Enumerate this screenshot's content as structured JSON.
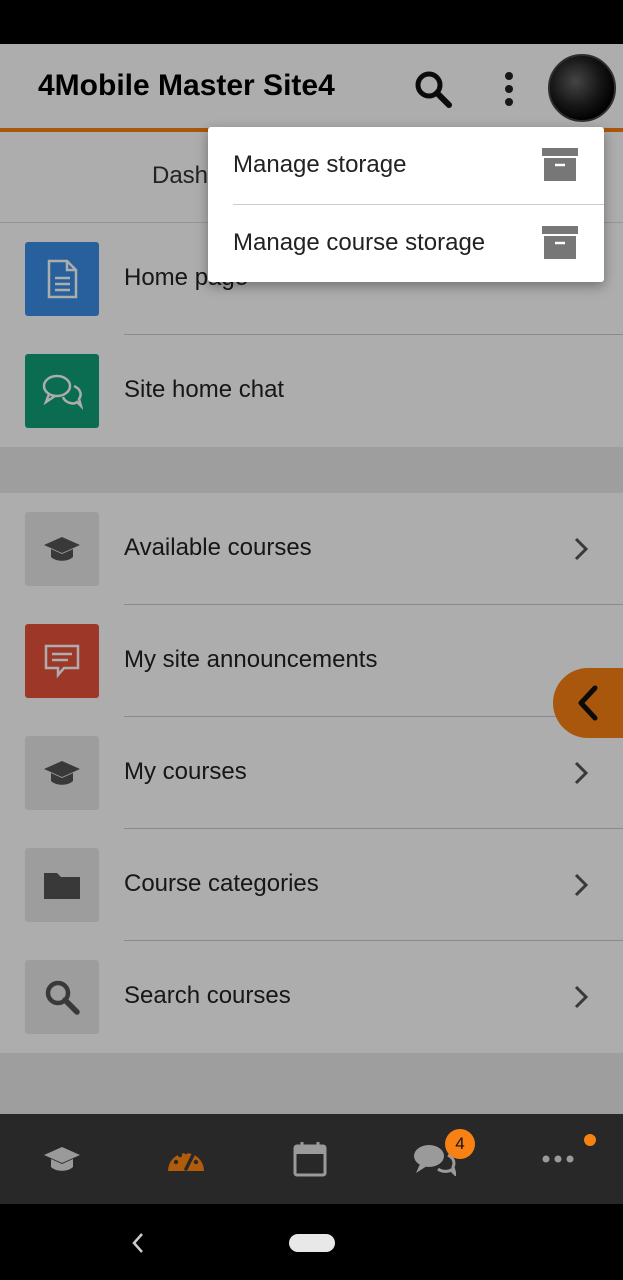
{
  "header": {
    "title": "4Mobile Master Site4"
  },
  "tabs": {
    "active_label": "Dash"
  },
  "site_section": {
    "items": [
      {
        "label": "Home page",
        "icon": "document-icon",
        "color": "#3a8ee6"
      },
      {
        "label": "Site home chat",
        "icon": "chat-icon",
        "color": "#10a078"
      }
    ]
  },
  "course_section": {
    "items": [
      {
        "label": "Available courses",
        "icon": "graduation-cap-icon",
        "chevron": true
      },
      {
        "label": "My site announcements",
        "icon": "announcement-icon",
        "color": "#e8533c",
        "chevron": false
      },
      {
        "label": "My courses",
        "icon": "graduation-cap-icon",
        "chevron": true
      },
      {
        "label": "Course categories",
        "icon": "folder-icon",
        "chevron": true
      },
      {
        "label": "Search courses",
        "icon": "search-icon",
        "chevron": true
      }
    ]
  },
  "popover": {
    "items": [
      {
        "label": "Manage storage",
        "icon": "archive-icon"
      },
      {
        "label": "Manage course storage",
        "icon": "archive-icon"
      }
    ]
  },
  "bottom_nav": {
    "messages_badge": "4",
    "tabs": [
      "courses",
      "dashboard",
      "calendar",
      "messages",
      "more"
    ]
  },
  "colors": {
    "accent": "#f98012",
    "nav_background": "#282828"
  }
}
